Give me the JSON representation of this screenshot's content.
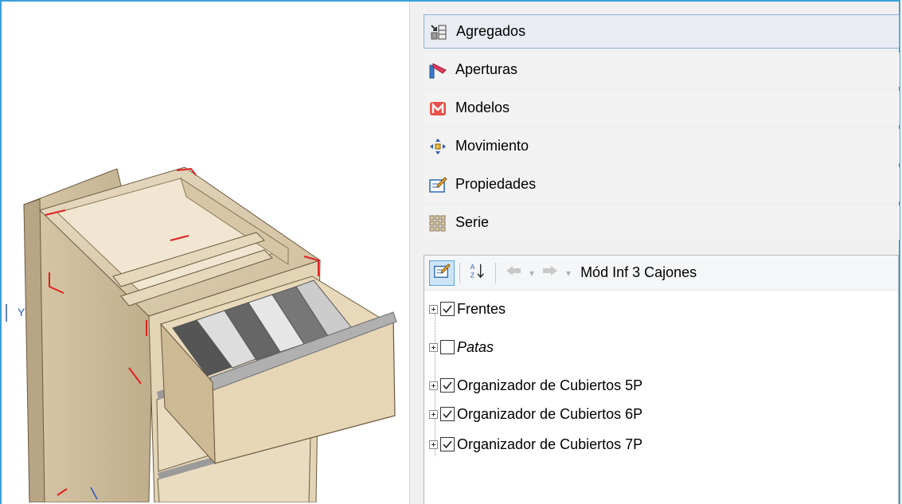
{
  "categories": [
    {
      "label": "Agregados",
      "icon": "agregados-icon",
      "selected": true
    },
    {
      "label": "Aperturas",
      "icon": "aperturas-icon",
      "selected": false
    },
    {
      "label": "Modelos",
      "icon": "modelos-icon",
      "selected": false
    },
    {
      "label": "Movimiento",
      "icon": "movimiento-icon",
      "selected": false
    },
    {
      "label": "Propiedades",
      "icon": "propiedades-icon",
      "selected": false
    },
    {
      "label": "Serie",
      "icon": "serie-icon",
      "selected": false
    }
  ],
  "toolbar": {
    "title": "Mód Inf 3 Cajones",
    "sort_icon": "sort-az-icon",
    "back_icon": "back-arrow-icon",
    "forward_icon": "forward-arrow-icon"
  },
  "tree": [
    {
      "label": "Frentes",
      "checked": true,
      "italic": false
    },
    {
      "label": "Patas",
      "checked": false,
      "italic": true
    },
    {
      "label": "Organizador de Cubiertos  5P",
      "checked": true,
      "italic": false
    },
    {
      "label": "Organizador de Cubiertos  6P",
      "checked": true,
      "italic": false
    },
    {
      "label": "Organizador de Cubiertos  7P",
      "checked": true,
      "italic": false
    }
  ],
  "viewport": {
    "axis_label": "Y",
    "accent_color": "#3aa0d8",
    "marker_color": "#e02020"
  }
}
